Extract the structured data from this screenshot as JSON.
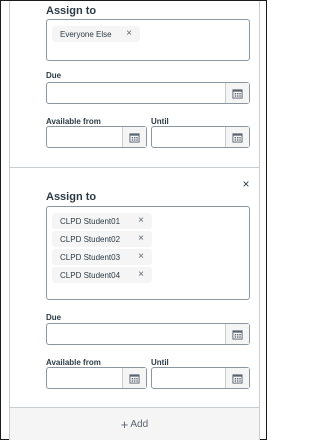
{
  "card1": {
    "assign_heading": "Assign to",
    "assignees": [
      "Everyone Else"
    ],
    "due_label": "Due",
    "available_from_label": "Available from",
    "until_label": "Until"
  },
  "card2": {
    "assign_heading": "Assign to",
    "assignees": [
      "CLPD Student01",
      "CLPD Student02",
      "CLPD Student03",
      "CLPD Student04"
    ],
    "due_label": "Due",
    "available_from_label": "Available from",
    "until_label": "Until",
    "close_icon": "×"
  },
  "footer": {
    "add_label": "Add",
    "add_icon": "+"
  },
  "icons": {
    "remove": "×",
    "calendar": "calendar-icon"
  },
  "colors": {
    "border": "#8b969e",
    "divider": "#c7cdd1",
    "pill_bg": "#f5f5f5",
    "text": "#2d3b45"
  }
}
